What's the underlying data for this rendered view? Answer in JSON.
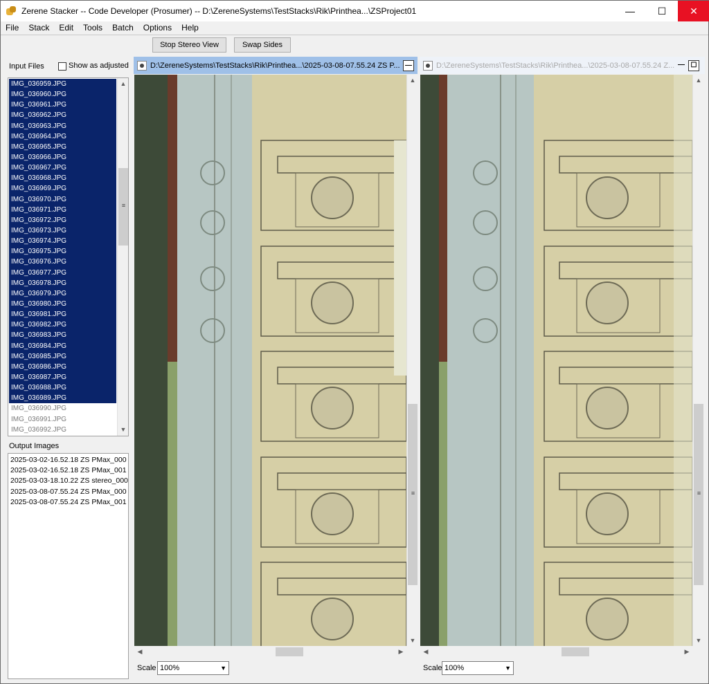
{
  "window": {
    "title": "Zerene Stacker -- Code Developer (Prosumer) -- D:\\ZereneSystems\\TestStacks\\Rik\\Printhea...\\ZSProject01",
    "min": "—",
    "max": "☐",
    "close": "✕"
  },
  "menu": [
    "File",
    "Stack",
    "Edit",
    "Tools",
    "Batch",
    "Options",
    "Help"
  ],
  "toolbar": {
    "stop_stereo": "Stop Stereo View",
    "swap_sides": "Swap Sides"
  },
  "input_files": {
    "header": "Input Files",
    "show_adjusted": "Show as adjusted",
    "selected": [
      "IMG_036959.JPG",
      "IMG_036960.JPG",
      "IMG_036961.JPG",
      "IMG_036962.JPG",
      "IMG_036963.JPG",
      "IMG_036964.JPG",
      "IMG_036965.JPG",
      "IMG_036966.JPG",
      "IMG_036967.JPG",
      "IMG_036968.JPG",
      "IMG_036969.JPG",
      "IMG_036970.JPG",
      "IMG_036971.JPG",
      "IMG_036972.JPG",
      "IMG_036973.JPG",
      "IMG_036974.JPG",
      "IMG_036975.JPG",
      "IMG_036976.JPG",
      "IMG_036977.JPG",
      "IMG_036978.JPG",
      "IMG_036979.JPG",
      "IMG_036980.JPG",
      "IMG_036981.JPG",
      "IMG_036982.JPG",
      "IMG_036983.JPG",
      "IMG_036984.JPG",
      "IMG_036985.JPG",
      "IMG_036986.JPG",
      "IMG_036987.JPG",
      "IMG_036988.JPG",
      "IMG_036989.JPG"
    ],
    "unselected": [
      "IMG_036990.JPG",
      "IMG_036991.JPG",
      "IMG_036992.JPG"
    ]
  },
  "output_images": {
    "header": "Output Images",
    "items": [
      "2025-03-02-16.52.18 ZS PMax_000",
      "2025-03-02-16.52.18 ZS PMax_001",
      "2025-03-03-18.10.22 ZS stereo_000",
      "2025-03-08-07.55.24 ZS PMax_000",
      "2025-03-08-07.55.24 ZS PMax_001"
    ]
  },
  "left_pane": {
    "title": "D:\\ZereneSystems\\TestStacks\\Rik\\Printhea...\\2025-03-08-07.55.24 ZS P...",
    "scale_label": "Scale",
    "scale_value": "100%",
    "min_btn": "—"
  },
  "right_pane": {
    "title": "D:\\ZereneSystems\\TestStacks\\Rik\\Printhea...\\2025-03-08-07.55.24 Z...",
    "scale_label": "Scale",
    "scale_value": "100%",
    "min_btn": "—",
    "max_btn": "☐"
  },
  "icons": [
    "app-icon",
    "document-icon",
    "minimize-icon",
    "maximize-icon",
    "close-icon",
    "scroll-up-icon",
    "scroll-down-icon",
    "scroll-left-icon",
    "scroll-right-icon",
    "dropdown-caret-icon"
  ]
}
